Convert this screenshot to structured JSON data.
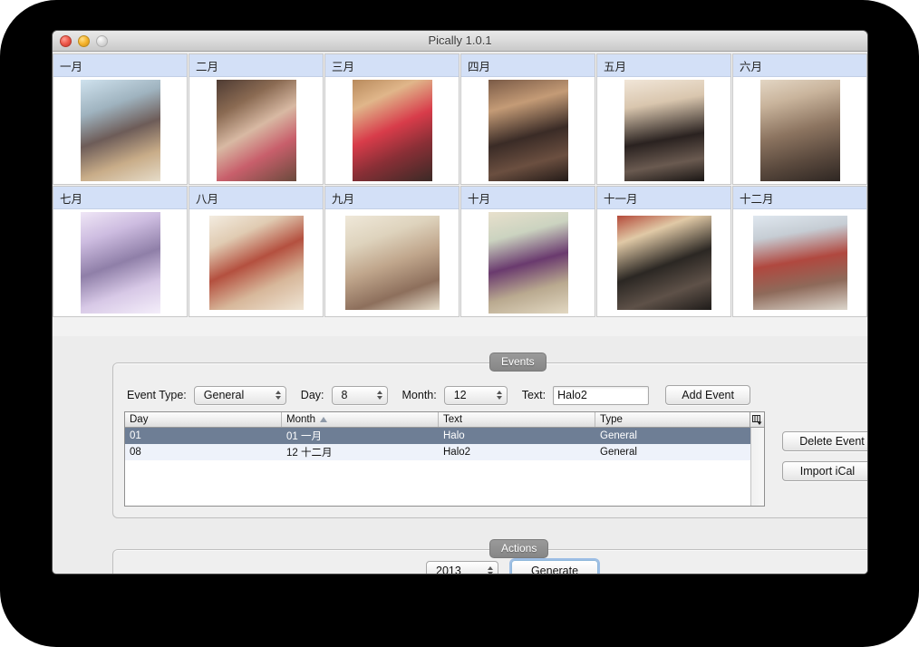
{
  "window": {
    "title": "Pically 1.0.1",
    "controls": {
      "close": "close-button",
      "minimize": "minimize-button",
      "zoom": "zoom-button"
    }
  },
  "calendar": {
    "months": [
      {
        "label": "一月",
        "thumb": "t1"
      },
      {
        "label": "二月",
        "thumb": "t2"
      },
      {
        "label": "三月",
        "thumb": "t3"
      },
      {
        "label": "四月",
        "thumb": "t4"
      },
      {
        "label": "五月",
        "thumb": "t5"
      },
      {
        "label": "六月",
        "thumb": "t6"
      },
      {
        "label": "七月",
        "thumb": "t7"
      },
      {
        "label": "八月",
        "thumb": "t8"
      },
      {
        "label": "九月",
        "thumb": "t9"
      },
      {
        "label": "十月",
        "thumb": "t10"
      },
      {
        "label": "十一月",
        "thumb": "t11"
      },
      {
        "label": "十二月",
        "thumb": "t12"
      }
    ]
  },
  "events": {
    "tab_label": "Events",
    "form": {
      "event_type_label": "Event Type:",
      "event_type_value": "General",
      "day_label": "Day:",
      "day_value": "8",
      "month_label": "Month:",
      "month_value": "12",
      "text_label": "Text:",
      "text_value": "Halo2",
      "text_placeholder": "",
      "add_event_label": "Add Event"
    },
    "table": {
      "columns": [
        "Day",
        "Month",
        "Text",
        "Type"
      ],
      "sorted_column": "Month",
      "sort_direction": "ascending",
      "rows": [
        {
          "day": "01",
          "month": "01 一月",
          "text": "Halo",
          "type": "General",
          "selected": true
        },
        {
          "day": "08",
          "month": "12 十二月",
          "text": "Halo2",
          "type": "General",
          "selected": false
        }
      ]
    },
    "buttons": {
      "delete_event": "Delete Event",
      "import_ical": "Import iCal"
    }
  },
  "actions": {
    "tab_label": "Actions",
    "year_value": "2013",
    "generate_label": "Generate"
  },
  "colors": {
    "month_header": "#d3e0f7",
    "selection": "#6e7e95",
    "alt_row": "#eef2fa",
    "accent_focus": "#5a96dc",
    "desktop": "#000000"
  }
}
